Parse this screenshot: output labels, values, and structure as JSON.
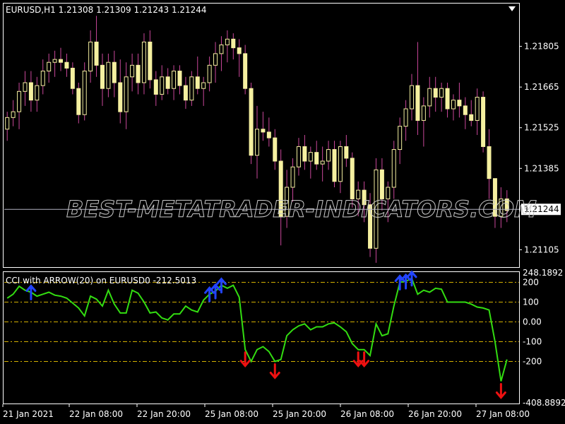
{
  "colors": {
    "background": "#000000",
    "frame": "#ffffff",
    "bull": "#000000",
    "bull_stroke": "#f5f0a0",
    "bear_fill": "#f5f0a0",
    "wick": "#c9479a",
    "cci_line": "#33dd11",
    "level_line": "#d4b000",
    "arrow_up": "#2244ff",
    "arrow_down": "#ee1111",
    "price_line": "#b0b0c0"
  },
  "main_chart": {
    "header": "EURUSD,H1  1.21308 1.21309 1.21243 1.21244",
    "current_price_label": "1.21244",
    "watermark": "BEST-METATRADER-INDICATORS.COM"
  },
  "indicator": {
    "header": "CCI with ARROW(20) on EURUSD0 -212.5013"
  },
  "x_axis": {
    "labels": [
      "21 Jan 2021",
      "22 Jan 08:00",
      "22 Jan 20:00",
      "25 Jan 08:00",
      "25 Jan 20:00",
      "26 Jan 08:00",
      "26 Jan 20:00",
      "27 Jan 08:00"
    ]
  },
  "chart_data": [
    {
      "type": "candlestick",
      "title": "EURUSD,H1",
      "symbol": "EURUSD",
      "timeframe": "H1",
      "quote": {
        "open": 1.21308,
        "high": 1.21309,
        "low": 1.21243,
        "close": 1.21244
      },
      "y_ticks": [
        1.21805,
        1.21665,
        1.21525,
        1.21385,
        1.21105
      ],
      "ylim": [
        1.2105,
        1.2195
      ],
      "current_price": 1.21244,
      "candles": [
        {
          "o": 1.2152,
          "h": 1.2158,
          "l": 1.2148,
          "c": 1.2156
        },
        {
          "o": 1.2156,
          "h": 1.2162,
          "l": 1.2153,
          "c": 1.2158
        },
        {
          "o": 1.2158,
          "h": 1.2168,
          "l": 1.2152,
          "c": 1.2165
        },
        {
          "o": 1.2165,
          "h": 1.2172,
          "l": 1.216,
          "c": 1.2168
        },
        {
          "o": 1.2168,
          "h": 1.2172,
          "l": 1.2158,
          "c": 1.2162
        },
        {
          "o": 1.2162,
          "h": 1.217,
          "l": 1.2158,
          "c": 1.2167
        },
        {
          "o": 1.2167,
          "h": 1.2176,
          "l": 1.2164,
          "c": 1.2172
        },
        {
          "o": 1.2172,
          "h": 1.2178,
          "l": 1.2168,
          "c": 1.2175
        },
        {
          "o": 1.2175,
          "h": 1.2179,
          "l": 1.217,
          "c": 1.2176
        },
        {
          "o": 1.2176,
          "h": 1.218,
          "l": 1.2172,
          "c": 1.2175
        },
        {
          "o": 1.2175,
          "h": 1.2178,
          "l": 1.217,
          "c": 1.2173
        },
        {
          "o": 1.2173,
          "h": 1.2175,
          "l": 1.2164,
          "c": 1.2166
        },
        {
          "o": 1.2166,
          "h": 1.2168,
          "l": 1.2154,
          "c": 1.2157
        },
        {
          "o": 1.2157,
          "h": 1.2175,
          "l": 1.2155,
          "c": 1.2172
        },
        {
          "o": 1.2172,
          "h": 1.2186,
          "l": 1.2168,
          "c": 1.2182
        },
        {
          "o": 1.2182,
          "h": 1.2191,
          "l": 1.217,
          "c": 1.2174
        },
        {
          "o": 1.2174,
          "h": 1.2178,
          "l": 1.216,
          "c": 1.2166
        },
        {
          "o": 1.2166,
          "h": 1.2178,
          "l": 1.2163,
          "c": 1.2175
        },
        {
          "o": 1.2175,
          "h": 1.2179,
          "l": 1.2163,
          "c": 1.2168
        },
        {
          "o": 1.2168,
          "h": 1.2176,
          "l": 1.2154,
          "c": 1.2158
        },
        {
          "o": 1.2158,
          "h": 1.2175,
          "l": 1.2152,
          "c": 1.217
        },
        {
          "o": 1.217,
          "h": 1.2178,
          "l": 1.2165,
          "c": 1.2174
        },
        {
          "o": 1.2174,
          "h": 1.2178,
          "l": 1.2164,
          "c": 1.2168
        },
        {
          "o": 1.2168,
          "h": 1.2185,
          "l": 1.2164,
          "c": 1.2182
        },
        {
          "o": 1.2182,
          "h": 1.2186,
          "l": 1.2166,
          "c": 1.2169
        },
        {
          "o": 1.2169,
          "h": 1.2172,
          "l": 1.216,
          "c": 1.2164
        },
        {
          "o": 1.2164,
          "h": 1.2174,
          "l": 1.2162,
          "c": 1.217
        },
        {
          "o": 1.217,
          "h": 1.2173,
          "l": 1.2164,
          "c": 1.2166
        },
        {
          "o": 1.2166,
          "h": 1.2174,
          "l": 1.2162,
          "c": 1.2172
        },
        {
          "o": 1.2172,
          "h": 1.2174,
          "l": 1.2164,
          "c": 1.2167
        },
        {
          "o": 1.2167,
          "h": 1.217,
          "l": 1.2159,
          "c": 1.2162
        },
        {
          "o": 1.2162,
          "h": 1.2172,
          "l": 1.216,
          "c": 1.217
        },
        {
          "o": 1.217,
          "h": 1.2177,
          "l": 1.2164,
          "c": 1.2166
        },
        {
          "o": 1.2166,
          "h": 1.217,
          "l": 1.216,
          "c": 1.2168
        },
        {
          "o": 1.2168,
          "h": 1.2177,
          "l": 1.2165,
          "c": 1.2174
        },
        {
          "o": 1.2174,
          "h": 1.2182,
          "l": 1.2168,
          "c": 1.2178
        },
        {
          "o": 1.2178,
          "h": 1.2184,
          "l": 1.2172,
          "c": 1.2181
        },
        {
          "o": 1.2181,
          "h": 1.2186,
          "l": 1.2175,
          "c": 1.2183
        },
        {
          "o": 1.2183,
          "h": 1.2185,
          "l": 1.2176,
          "c": 1.218
        },
        {
          "o": 1.218,
          "h": 1.2183,
          "l": 1.217,
          "c": 1.2178
        },
        {
          "o": 1.2178,
          "h": 1.2181,
          "l": 1.2164,
          "c": 1.2166
        },
        {
          "o": 1.2166,
          "h": 1.2168,
          "l": 1.214,
          "c": 1.2143
        },
        {
          "o": 1.2143,
          "h": 1.216,
          "l": 1.2135,
          "c": 1.2152
        },
        {
          "o": 1.2152,
          "h": 1.2158,
          "l": 1.2148,
          "c": 1.2151
        },
        {
          "o": 1.2151,
          "h": 1.2156,
          "l": 1.2146,
          "c": 1.2149
        },
        {
          "o": 1.2149,
          "h": 1.2152,
          "l": 1.2138,
          "c": 1.2141
        },
        {
          "o": 1.2141,
          "h": 1.2145,
          "l": 1.2112,
          "c": 1.2122
        },
        {
          "o": 1.2122,
          "h": 1.2138,
          "l": 1.2118,
          "c": 1.2132
        },
        {
          "o": 1.2132,
          "h": 1.2142,
          "l": 1.2127,
          "c": 1.2139
        },
        {
          "o": 1.2139,
          "h": 1.2149,
          "l": 1.2136,
          "c": 1.2146
        },
        {
          "o": 1.2146,
          "h": 1.215,
          "l": 1.2138,
          "c": 1.2141
        },
        {
          "o": 1.2141,
          "h": 1.2146,
          "l": 1.2135,
          "c": 1.2144
        },
        {
          "o": 1.2144,
          "h": 1.2148,
          "l": 1.2138,
          "c": 1.214
        },
        {
          "o": 1.214,
          "h": 1.2146,
          "l": 1.2134,
          "c": 1.2141
        },
        {
          "o": 1.2141,
          "h": 1.2148,
          "l": 1.2138,
          "c": 1.2145
        },
        {
          "o": 1.2145,
          "h": 1.2148,
          "l": 1.2132,
          "c": 1.2134
        },
        {
          "o": 1.2134,
          "h": 1.2148,
          "l": 1.213,
          "c": 1.2146
        },
        {
          "o": 1.2146,
          "h": 1.215,
          "l": 1.2139,
          "c": 1.2142
        },
        {
          "o": 1.2142,
          "h": 1.2144,
          "l": 1.2125,
          "c": 1.2128
        },
        {
          "o": 1.2128,
          "h": 1.2134,
          "l": 1.2122,
          "c": 1.2131
        },
        {
          "o": 1.2131,
          "h": 1.2134,
          "l": 1.212,
          "c": 1.2126
        },
        {
          "o": 1.2126,
          "h": 1.213,
          "l": 1.2108,
          "c": 1.2111
        },
        {
          "o": 1.2111,
          "h": 1.2142,
          "l": 1.2106,
          "c": 1.2138
        },
        {
          "o": 1.2138,
          "h": 1.2142,
          "l": 1.2124,
          "c": 1.2128
        },
        {
          "o": 1.2128,
          "h": 1.2134,
          "l": 1.212,
          "c": 1.2132
        },
        {
          "o": 1.2132,
          "h": 1.2148,
          "l": 1.2128,
          "c": 1.2145
        },
        {
          "o": 1.2145,
          "h": 1.2156,
          "l": 1.214,
          "c": 1.2153
        },
        {
          "o": 1.2153,
          "h": 1.2162,
          "l": 1.2148,
          "c": 1.2159
        },
        {
          "o": 1.2159,
          "h": 1.2171,
          "l": 1.2155,
          "c": 1.2167
        },
        {
          "o": 1.2167,
          "h": 1.2182,
          "l": 1.215,
          "c": 1.2155
        },
        {
          "o": 1.2155,
          "h": 1.2163,
          "l": 1.2146,
          "c": 1.216
        },
        {
          "o": 1.216,
          "h": 1.217,
          "l": 1.2156,
          "c": 1.2166
        },
        {
          "o": 1.2166,
          "h": 1.217,
          "l": 1.2158,
          "c": 1.2163
        },
        {
          "o": 1.2163,
          "h": 1.2168,
          "l": 1.2158,
          "c": 1.2166
        },
        {
          "o": 1.2166,
          "h": 1.2168,
          "l": 1.2156,
          "c": 1.2159
        },
        {
          "o": 1.2159,
          "h": 1.2164,
          "l": 1.2155,
          "c": 1.2162
        },
        {
          "o": 1.2162,
          "h": 1.2168,
          "l": 1.2156,
          "c": 1.216
        },
        {
          "o": 1.216,
          "h": 1.2163,
          "l": 1.2152,
          "c": 1.2157
        },
        {
          "o": 1.2157,
          "h": 1.2162,
          "l": 1.2153,
          "c": 1.2155
        },
        {
          "o": 1.2155,
          "h": 1.2166,
          "l": 1.215,
          "c": 1.2163
        },
        {
          "o": 1.2163,
          "h": 1.2165,
          "l": 1.2144,
          "c": 1.2146
        },
        {
          "o": 1.2146,
          "h": 1.2152,
          "l": 1.2128,
          "c": 1.2135
        },
        {
          "o": 1.2135,
          "h": 1.2134,
          "l": 1.2118,
          "c": 1.2122
        },
        {
          "o": 1.2122,
          "h": 1.2132,
          "l": 1.2118,
          "c": 1.2128
        },
        {
          "o": 1.2128,
          "h": 1.2131,
          "l": 1.212,
          "c": 1.2124
        }
      ]
    },
    {
      "type": "line",
      "title": "CCI with ARROW(20) on EURUSD0 -212.5013",
      "series": [
        {
          "values": [
            120,
            140,
            180,
            160,
            150,
            130,
            140,
            150,
            135,
            130,
            120,
            95,
            70,
            30,
            130,
            115,
            80,
            160,
            90,
            45,
            45,
            160,
            145,
            100,
            45,
            50,
            20,
            10,
            40,
            40,
            80,
            60,
            50,
            110,
            140,
            155,
            185,
            170,
            185,
            125,
            -140,
            -200,
            -140,
            -125,
            -150,
            -200,
            -190,
            -70,
            -40,
            -20,
            -10,
            -40,
            -25,
            -25,
            -10,
            -5,
            -25,
            -50,
            -110,
            -140,
            -140,
            -170,
            -10,
            -70,
            -60,
            80,
            200,
            205,
            220,
            140,
            160,
            150,
            170,
            165,
            100,
            100,
            100,
            100,
            90,
            75,
            70,
            60,
            -100,
            -300,
            -190
          ]
        }
      ],
      "reference_lines": [
        200,
        100,
        0,
        -100,
        -200
      ],
      "y_ticks": [
        248.1892,
        200,
        100,
        0.0,
        -100,
        -200,
        -408.8892
      ],
      "y_tick_labels": [
        "248.1892",
        "200",
        "100",
        "0.00",
        "-100",
        "-200",
        "-408.8892"
      ],
      "ylim": [
        -408.8892,
        248.1892
      ],
      "arrows": {
        "up": [
          4,
          34,
          35,
          36,
          66,
          67,
          68
        ],
        "down": [
          40,
          45,
          59,
          60,
          83
        ]
      }
    }
  ]
}
